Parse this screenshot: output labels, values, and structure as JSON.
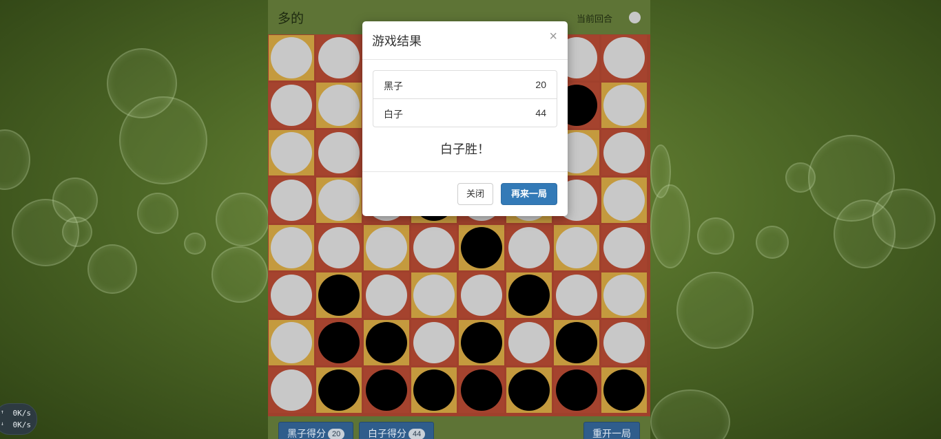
{
  "header": {
    "title": "多的",
    "turn_label": "当前回合",
    "turn_piece": "white"
  },
  "board": {
    "size": 8,
    "colors": {
      "dark_square": "#a5432e",
      "light_square": "#c49a3e",
      "white_piece": "#c8c8c8",
      "black_piece": "#000000"
    },
    "squares": [
      [
        "light",
        "dark",
        "light",
        "dark",
        "light",
        "dark",
        "dark",
        "dark"
      ],
      [
        "dark",
        "light",
        "dark",
        "light",
        "dark",
        "light",
        "dark",
        "light"
      ],
      [
        "light",
        "dark",
        "light",
        "dark",
        "light",
        "dark",
        "light",
        "dark"
      ],
      [
        "dark",
        "light",
        "dark",
        "light",
        "dark",
        "light",
        "dark",
        "light"
      ],
      [
        "light",
        "dark",
        "light",
        "dark",
        "light",
        "dark",
        "light",
        "dark"
      ],
      [
        "dark",
        "light",
        "dark",
        "light",
        "dark",
        "light",
        "dark",
        "light"
      ],
      [
        "light",
        "dark",
        "light",
        "dark",
        "light",
        "dark",
        "light",
        "dark"
      ],
      [
        "dark",
        "light",
        "dark",
        "light",
        "dark",
        "light",
        "dark",
        "light"
      ]
    ],
    "pieces": [
      [
        "W",
        "W",
        "W",
        "W",
        "W",
        "W",
        "W",
        "W"
      ],
      [
        "W",
        "W",
        "W",
        "W",
        "W",
        "W",
        "B",
        "W"
      ],
      [
        "W",
        "W",
        "W",
        "W",
        "W",
        "W",
        "W",
        "W"
      ],
      [
        "W",
        "W",
        "W",
        "B",
        "W",
        "W",
        "W",
        "W"
      ],
      [
        "W",
        "W",
        "W",
        "W",
        "B",
        "W",
        "W",
        "W"
      ],
      [
        "W",
        "B",
        "W",
        "W",
        "W",
        "B",
        "W",
        "W"
      ],
      [
        "W",
        "B",
        "B",
        "W",
        "B",
        "W",
        "B",
        "W"
      ],
      [
        "W",
        "B",
        "B",
        "B",
        "B",
        "B",
        "B",
        "B"
      ]
    ]
  },
  "footer": {
    "black_score_label": "黑子得分",
    "black_score": "20",
    "white_score_label": "白子得分",
    "white_score": "44",
    "restart_label": "重开一局"
  },
  "speed_widget": {
    "upload": "0K/s",
    "download": "0K/s"
  },
  "modal": {
    "title": "游戏结果",
    "close_symbol": "×",
    "rows": [
      {
        "label": "黑子",
        "value": "20"
      },
      {
        "label": "白子",
        "value": "44"
      }
    ],
    "winner": "白子胜！",
    "close_button": "关闭",
    "again_button": "再来一局"
  }
}
